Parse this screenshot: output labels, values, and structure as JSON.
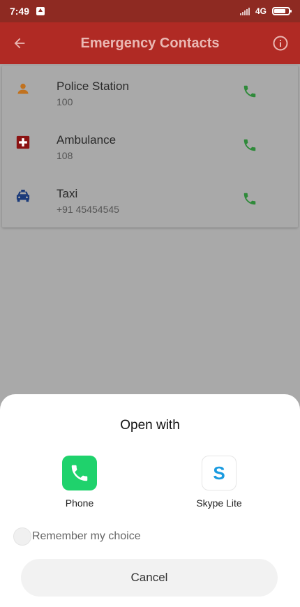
{
  "status_bar": {
    "time": "7:49",
    "network": "4G"
  },
  "app_bar": {
    "title": "Emergency Contacts",
    "back_icon": "arrow-left-icon",
    "info_icon": "info-icon"
  },
  "contacts": [
    {
      "name": "Police Station",
      "number": "100",
      "icon": "person-icon",
      "icon_color": "#c1721f"
    },
    {
      "name": "Ambulance",
      "number": "108",
      "icon": "medical-cross-icon",
      "icon_color": "#8b1212"
    },
    {
      "name": "Taxi",
      "number": "+91 45454545",
      "icon": "taxi-icon",
      "icon_color": "#1a3a7a"
    }
  ],
  "call_icon_color": "#2f8a3a",
  "sheet": {
    "title": "Open with",
    "apps": [
      {
        "label": "Phone",
        "icon": "phone-app-icon"
      },
      {
        "label": "Skype Lite",
        "icon": "skype-app-icon"
      }
    ],
    "remember_label": "Remember my choice",
    "cancel_label": "Cancel"
  },
  "colors": {
    "app_bar": "#b02a24",
    "status_bar": "#8e2a22",
    "scrim": "#a9a9a9"
  }
}
